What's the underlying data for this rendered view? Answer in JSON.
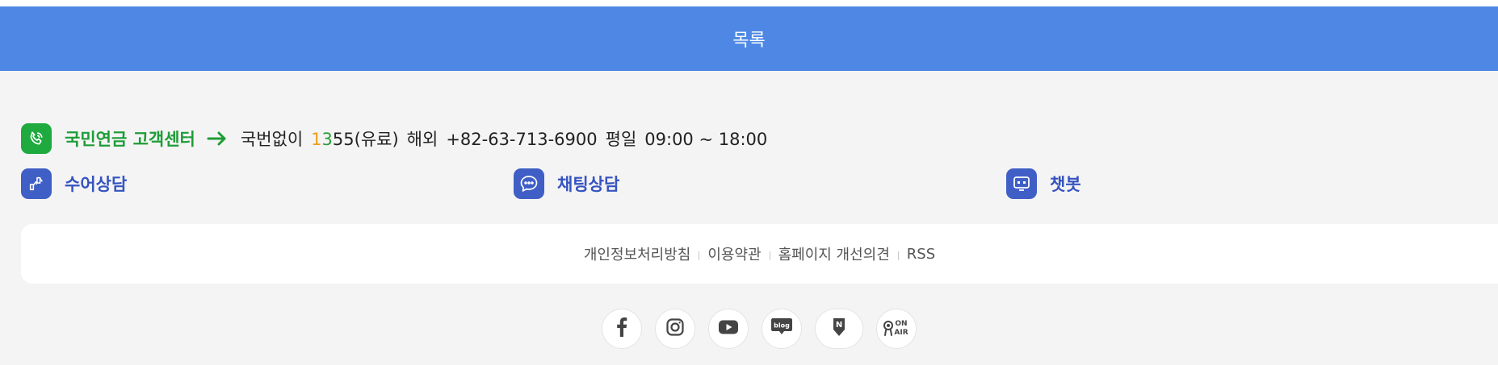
{
  "list_button": {
    "label": "목록"
  },
  "customer_center": {
    "title": "국민연금 고객센터",
    "prefix": "국번없이",
    "number_d1": "1",
    "number_d2": "3",
    "number_rest": "55",
    "paid": "(유료)",
    "overseas_label": "해외",
    "overseas_number": "+82-63-713-6900",
    "weekday_label": "평일",
    "hours": "09:00 ~ 18:00"
  },
  "services": [
    {
      "label": "수어상담",
      "icon": "sign-language-icon"
    },
    {
      "label": "채팅상담",
      "icon": "chat-bubble-icon"
    },
    {
      "label": "챗봇",
      "icon": "chatbot-icon"
    }
  ],
  "footer_links": [
    {
      "label": "개인정보처리방침"
    },
    {
      "label": "이용약관"
    },
    {
      "label": "홈페이지 개선의견"
    },
    {
      "label": "RSS"
    }
  ],
  "social": [
    {
      "name": "facebook",
      "icon": "facebook-icon"
    },
    {
      "name": "instagram",
      "icon": "instagram-icon"
    },
    {
      "name": "youtube",
      "icon": "youtube-icon"
    },
    {
      "name": "blog",
      "icon": "blog-icon",
      "badge_text": "blog"
    },
    {
      "name": "naver-post",
      "icon": "naver-post-icon",
      "badge_text": "N"
    },
    {
      "name": "on-air",
      "icon": "on-air-icon",
      "badge_text_1": "ON",
      "badge_text_2": "AIR"
    }
  ],
  "colors": {
    "list_bar": "#4e88e4",
    "center_green": "#1eaa3e",
    "service_blue": "#3f5fc6",
    "digit_orange": "#e8a01a"
  }
}
